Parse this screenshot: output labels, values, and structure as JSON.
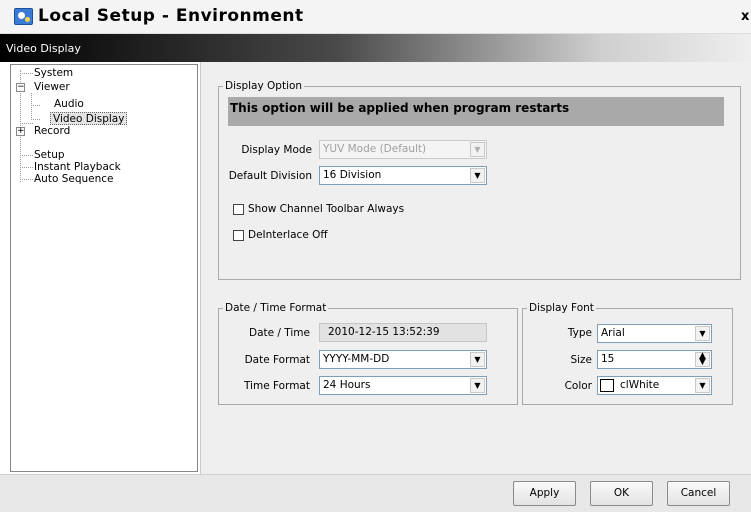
{
  "window": {
    "title": "Local Setup - Environment",
    "close_glyph": "x"
  },
  "header": {
    "title": "Video Display"
  },
  "tree": {
    "items": [
      {
        "label": "System"
      },
      {
        "label": "Viewer",
        "expander": "−"
      },
      {
        "label": "Audio"
      },
      {
        "label": "Video Display",
        "selected": true
      },
      {
        "label": "Record",
        "expander": "+"
      },
      {
        "label": "Setup"
      },
      {
        "label": "Instant Playback"
      },
      {
        "label": "Auto Sequence"
      }
    ]
  },
  "display_option": {
    "legend": "Display Option",
    "notice": "This option will be applied when program restarts",
    "display_mode_label": "Display Mode",
    "display_mode_value": "YUV Mode (Default)",
    "default_division_label": "Default Division",
    "default_division_value": "16 Division",
    "show_channel_toolbar_label": "Show Channel Toolbar Always",
    "show_channel_toolbar_checked": false,
    "deinterlace_label": "DeInterlace Off",
    "deinterlace_checked": false
  },
  "date_time": {
    "legend": "Date / Time Format",
    "datetime_label": "Date / Time",
    "datetime_value": "2010-12-15 13:52:39",
    "date_format_label": "Date Format",
    "date_format_value": "YYYY-MM-DD",
    "time_format_label": "Time Format",
    "time_format_value": "24 Hours"
  },
  "display_font": {
    "legend": "Display Font",
    "type_label": "Type",
    "type_value": "Arial",
    "size_label": "Size",
    "size_value": "15",
    "color_label": "Color",
    "color_value": "clWhite",
    "color_hex": "#ffffff"
  },
  "buttons": {
    "apply": "Apply",
    "ok": "OK",
    "cancel": "Cancel"
  }
}
